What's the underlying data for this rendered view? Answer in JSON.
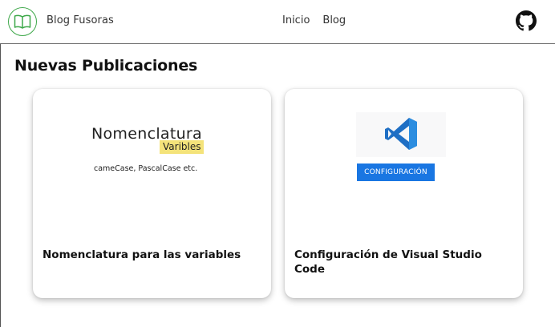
{
  "header": {
    "brand": "Blog Fusoras",
    "nav": [
      {
        "label": "Inicio"
      },
      {
        "label": "Blog"
      }
    ],
    "logo_icon": "book-icon",
    "github_icon": "github-icon",
    "accent_color": "#3ea84a"
  },
  "main": {
    "section_title": "Nuevas Publicaciones",
    "posts": [
      {
        "title": "Nomenclatura para las variables",
        "thumbnail": {
          "heading": "Nomenclatura",
          "badge": "Varibles",
          "subtitle": "cameCase, PascalCase etc.",
          "badge_color": "#f4e37a"
        }
      },
      {
        "title": "Configuración de Visual Studio Code",
        "thumbnail": {
          "icon": "vscode-icon",
          "button_label": "CONFIGURACIÓN",
          "button_color": "#1976e2"
        }
      }
    ]
  }
}
